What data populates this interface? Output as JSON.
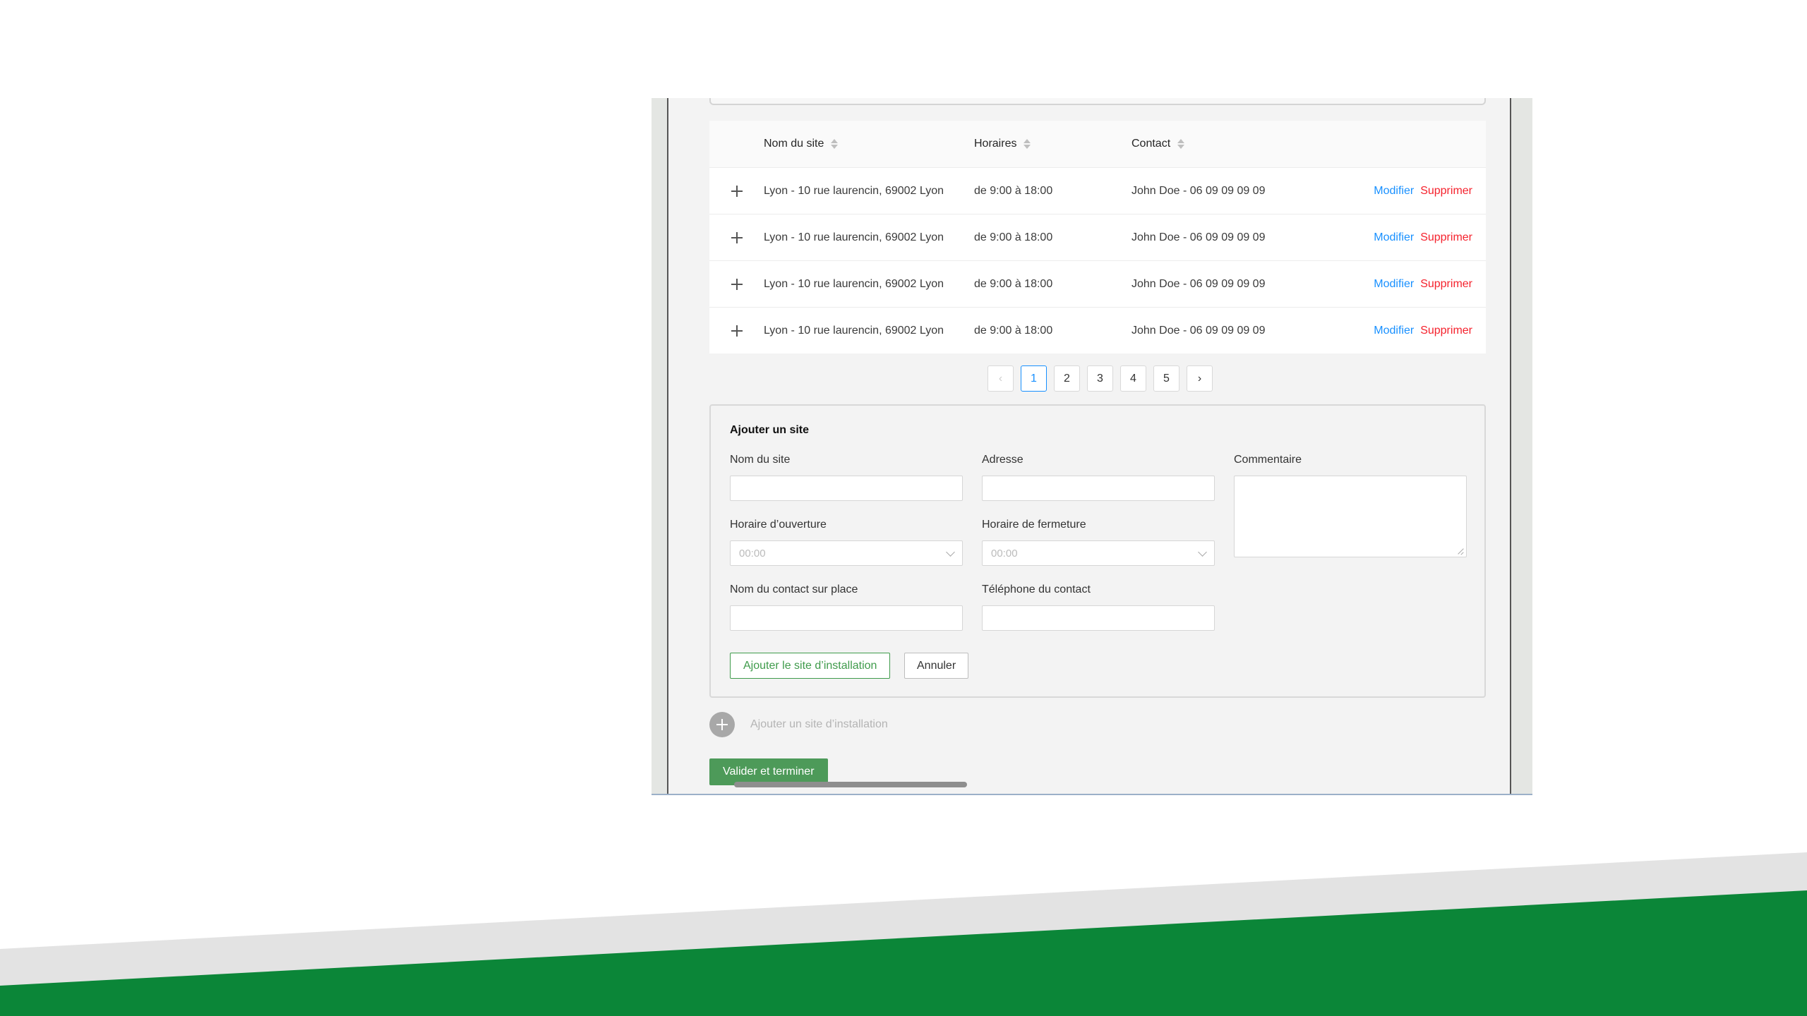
{
  "colors": {
    "brand_green": "#0b8638",
    "band_gray": "#e3e3e3",
    "link_blue": "#1890ff",
    "danger_red": "#f5222d",
    "button_green": "#4d9a59"
  },
  "table": {
    "columns": {
      "name": "Nom du site",
      "hours": "Horaires",
      "contact": "Contact"
    },
    "rows": [
      {
        "name": "Lyon - 10 rue laurencin, 69002 Lyon",
        "hours": "de 9:00 à 18:00",
        "contact": "John Doe - 06 09 09 09 09",
        "edit": "Modifier",
        "delete": "Supprimer"
      },
      {
        "name": "Lyon - 10 rue laurencin, 69002 Lyon",
        "hours": "de 9:00 à 18:00",
        "contact": "John Doe - 06 09 09 09 09",
        "edit": "Modifier",
        "delete": "Supprimer"
      },
      {
        "name": "Lyon - 10 rue laurencin, 69002 Lyon",
        "hours": "de 9:00 à 18:00",
        "contact": "John Doe - 06 09 09 09 09",
        "edit": "Modifier",
        "delete": "Supprimer"
      },
      {
        "name": "Lyon - 10 rue laurencin, 69002 Lyon",
        "hours": "de 9:00 à 18:00",
        "contact": "John Doe - 06 09 09 09 09",
        "edit": "Modifier",
        "delete": "Supprimer"
      }
    ]
  },
  "pagination": {
    "prev": "‹",
    "next": "›",
    "pages": [
      "1",
      "2",
      "3",
      "4",
      "5"
    ],
    "current": "1"
  },
  "form": {
    "title": "Ajouter un site",
    "site_name_label": "Nom du site",
    "address_label": "Adresse",
    "comment_label": "Commentaire",
    "opening_label": "Horaire d’ouverture",
    "opening_placeholder": "00:00",
    "closing_label": "Horaire de fermeture",
    "closing_placeholder": "00:00",
    "contact_name_label": "Nom du contact sur place",
    "contact_phone_label": "Téléphone du contact",
    "submit_label": "Ajouter le site d’installation",
    "cancel_label": "Annuler"
  },
  "add_site_link": "Ajouter un site d’installation",
  "validate_button": "Valider et terminer"
}
